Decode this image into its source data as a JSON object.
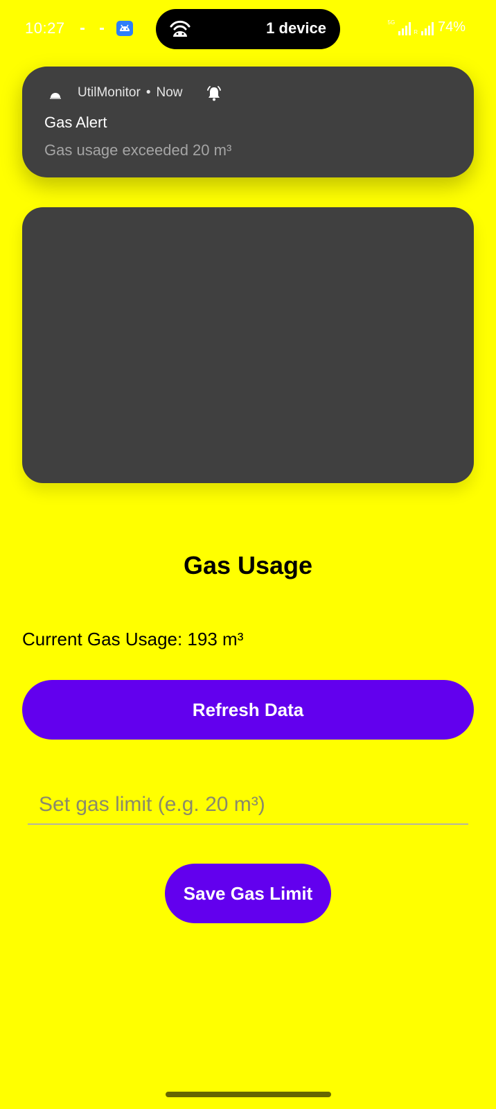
{
  "status_bar": {
    "time": "10:27",
    "pill_text": "1 device",
    "battery": "74%",
    "network_label": "5G",
    "sim2_label": "R",
    "icons": [
      "android-icon",
      "wireless-debug-icon",
      "signal-icon",
      "battery-icon"
    ]
  },
  "notification": {
    "app_name": "UtilMonitor",
    "separator": "•",
    "time": "Now",
    "title": "Gas Alert",
    "body": "Gas usage exceeded 20 m³",
    "icons": [
      "app-icon",
      "bell-icon"
    ]
  },
  "main": {
    "title": "Gas Usage",
    "usage_text": "Current Gas Usage: 193 m³",
    "refresh_label": "Refresh Data",
    "limit_placeholder": "Set gas limit (e.g. 20 m³)",
    "limit_value": "",
    "save_label": "Save Gas Limit"
  },
  "colors": {
    "background": "#ffff00",
    "accent": "#6200ee",
    "card": "#404040"
  }
}
